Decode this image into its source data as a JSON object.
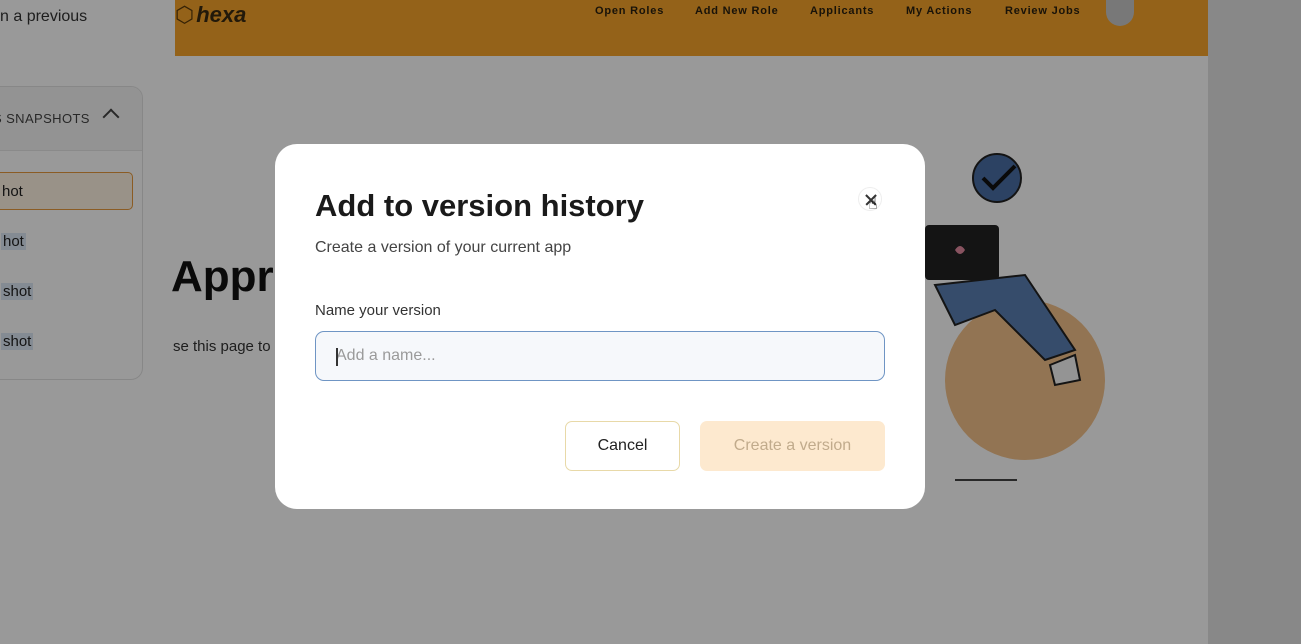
{
  "left_panel": {
    "hint_text": "n a previous",
    "snapshots_header": "S SNAPSHOTS",
    "items": [
      "hot",
      "hot",
      "shot",
      "shot"
    ]
  },
  "app": {
    "logo": "hexa",
    "nav": [
      "Open Roles",
      "Add New Role",
      "Applicants",
      "My Actions",
      "Review Jobs"
    ],
    "page_title": "Appro",
    "page_description": "se this page to"
  },
  "modal": {
    "title": "Add to version history",
    "subtitle": "Create a version of your current app",
    "field_label": "Name your version",
    "input_placeholder": "Add a name...",
    "input_value": "",
    "cancel_label": "Cancel",
    "create_label": "Create a version"
  },
  "colors": {
    "brand_orange": "#f7a42a",
    "active_border": "#e89a3c",
    "create_disabled_bg": "#fde9cf",
    "input_border": "#6f95c4"
  },
  "icons": {
    "close": "close-icon",
    "collapse": "chevron-up-icon",
    "avatar": "user-avatar-icon",
    "cursor": "hand-pointer-icon"
  }
}
